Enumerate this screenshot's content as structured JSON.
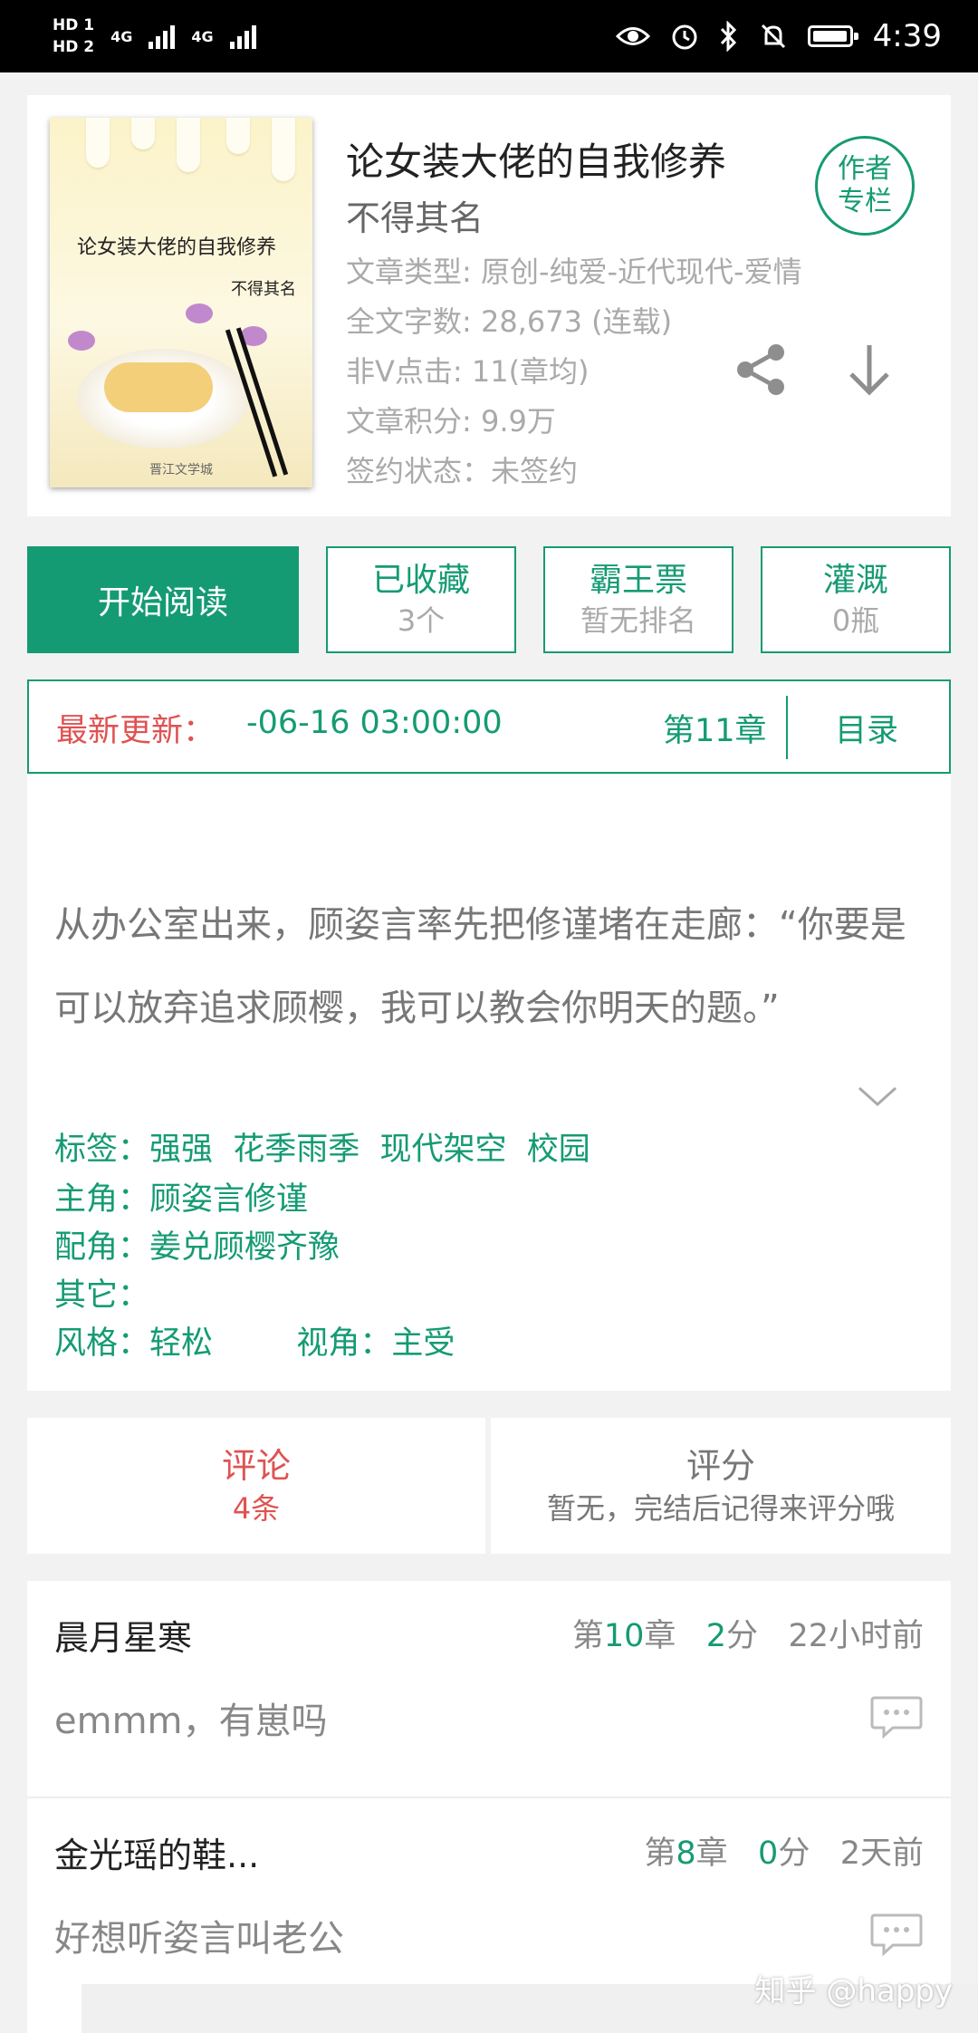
{
  "status_bar": {
    "hd1": "HD 1",
    "hd2": "HD 2",
    "net1": "4G",
    "net2": "4G",
    "time": "4:39"
  },
  "book": {
    "title": "论女装大佬的自我修养",
    "author": "不得其名",
    "cover_title": "论女装大佬的自我修养",
    "cover_author": "不得其名",
    "cover_publisher": "晋江文学城",
    "meta": [
      "文章类型: 原创-纯爱-近代现代-爱情",
      "全文字数: 28,673 (连载)",
      "非V点击: 11(章均)",
      "文章积分: 9.9万",
      "签约状态：未签约"
    ],
    "author_column": [
      "作者",
      "专栏"
    ]
  },
  "actions": {
    "read": "开始阅读",
    "collect_label": "已收藏",
    "collect_count": "3个",
    "vote_label": "霸王票",
    "vote_rank": "暂无排名",
    "water_label": "灌溉",
    "water_count": "0瓶"
  },
  "update": {
    "label": "最新更新：",
    "time": "-06-16 03:00:00",
    "chapter": "第11章",
    "toc": "目录"
  },
  "summary": {
    "text": "从办公室出来，顾姿言率先把修谨堵在走廊：“你要是可以放弃追求顾樱，我可以教会你明天的题。”",
    "tags_label": "标签：",
    "tags": "强强  花季雨季  现代架空  校园",
    "protagonist_label": "主角：",
    "protagonist": "顾姿言修谨",
    "supporting_label": "配角：",
    "supporting": "姜兑顾樱齐豫",
    "other_label": "其它：",
    "other": "",
    "style_label": "风格：",
    "style": "轻松",
    "view_label": "视角：",
    "view": "主受"
  },
  "comment_score": {
    "comment_label": "评论",
    "comment_count": "4条",
    "score_label": "评分",
    "score_note": "暂无，完结后记得来评分哦"
  },
  "comments": [
    {
      "user": "晨月星寒",
      "chapter_pre": "第",
      "chapter_num": "10",
      "chapter_post": "章",
      "score_num": "2",
      "score_unit": "分",
      "time": "22小时前",
      "text": "emmm，有崽吗"
    },
    {
      "user": "金光瑶的鞋...",
      "chapter_pre": "第",
      "chapter_num": "8",
      "chapter_post": "章",
      "score_num": "0",
      "score_unit": "分",
      "time": "2天前",
      "text": "好想听姿言叫老公"
    }
  ],
  "watermark": "知乎 @happy",
  "colors": {
    "accent": "#159b73",
    "alert": "#e05252"
  },
  "icons": [
    "eye-icon",
    "alarm-icon",
    "bluetooth-icon",
    "mute-icon",
    "battery-icon",
    "share-icon",
    "download-icon",
    "chevron-down-icon",
    "comment-bubble-icon"
  ]
}
